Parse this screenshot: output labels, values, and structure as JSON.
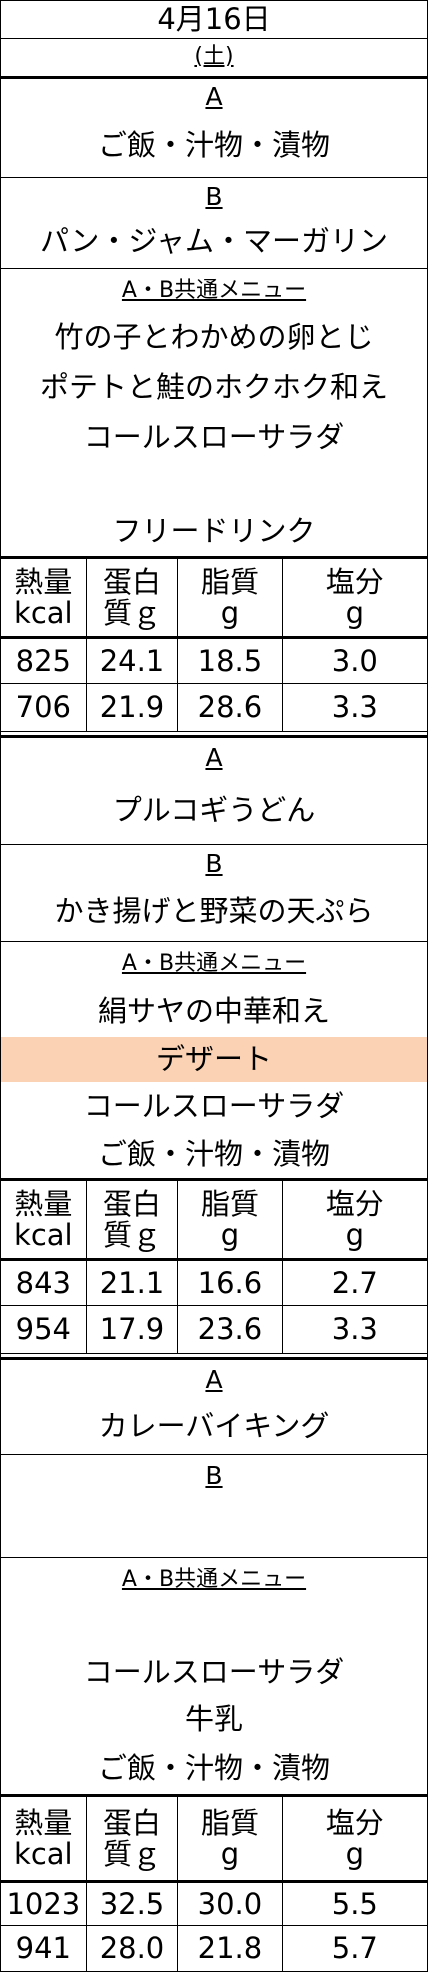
{
  "header": {
    "date": "4月16日",
    "weekday": "(土)"
  },
  "nutrition_headers": [
    {
      "l1": "熱量",
      "l2": "kcal"
    },
    {
      "l1": "蛋白",
      "l2": "質ｇ"
    },
    {
      "l1": "脂質",
      "l2": "g"
    },
    {
      "l1": "塩分",
      "l2": "g"
    }
  ],
  "meals": [
    {
      "a_label": "A",
      "a_items": [
        "ご飯・汁物・漬物"
      ],
      "b_label": "B",
      "b_items": [
        "パン・ジャム・マーガリン"
      ],
      "common_label": "A・B共通メニュー",
      "common_items": [
        "竹の子とわかめの卵とじ",
        "ポテトと鮭のホクホク和え",
        "コールスローサラダ",
        "",
        "フリードリンク"
      ],
      "nutrition": [
        [
          "825",
          "24.1",
          "18.5",
          "3.0"
        ],
        [
          "706",
          "21.9",
          "28.6",
          "3.3"
        ]
      ]
    },
    {
      "a_label": "A",
      "a_items": [
        "プルコギうどん"
      ],
      "b_label": "B",
      "b_items": [
        "かき揚げと野菜の天ぷら"
      ],
      "common_label": "A・B共通メニュー",
      "common_items": [
        "絹サヤの中華和え",
        "デザート",
        "コールスローサラダ",
        "ご飯・汁物・漬物"
      ],
      "nutrition": [
        [
          "843",
          "21.1",
          "16.6",
          "2.7"
        ],
        [
          "954",
          "17.9",
          "23.6",
          "3.3"
        ]
      ]
    },
    {
      "a_label": "A",
      "a_items": [
        "カレーバイキング"
      ],
      "b_label": "B",
      "b_items": [
        ""
      ],
      "common_label": "A・B共通メニュー",
      "common_items": [
        "",
        "コールスローサラダ",
        "牛乳",
        "ご飯・汁物・漬物"
      ],
      "nutrition": [
        [
          "1023",
          "32.5",
          "30.0",
          "5.5"
        ],
        [
          "941",
          "28.0",
          "21.8",
          "5.7"
        ]
      ]
    }
  ],
  "highlight_color": "#fbd3b4"
}
